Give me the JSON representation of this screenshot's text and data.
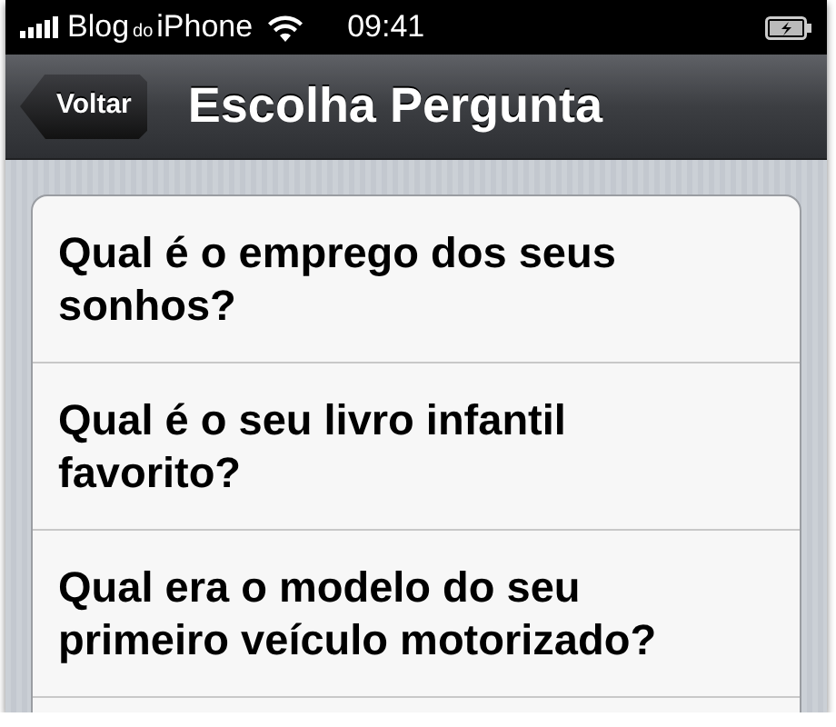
{
  "status_bar": {
    "carrier": {
      "before": "Blog",
      "small": "do",
      "after": "iPhone"
    },
    "time": "09:41"
  },
  "nav_bar": {
    "back": "Voltar",
    "title": "Escolha Pergunta"
  },
  "questions": [
    {
      "text": "Qual é o emprego dos seus sonhos?"
    },
    {
      "text": "Qual é o seu livro infantil favorito?"
    },
    {
      "text": "Qual era o modelo do seu primeiro veículo motorizado?"
    }
  ]
}
